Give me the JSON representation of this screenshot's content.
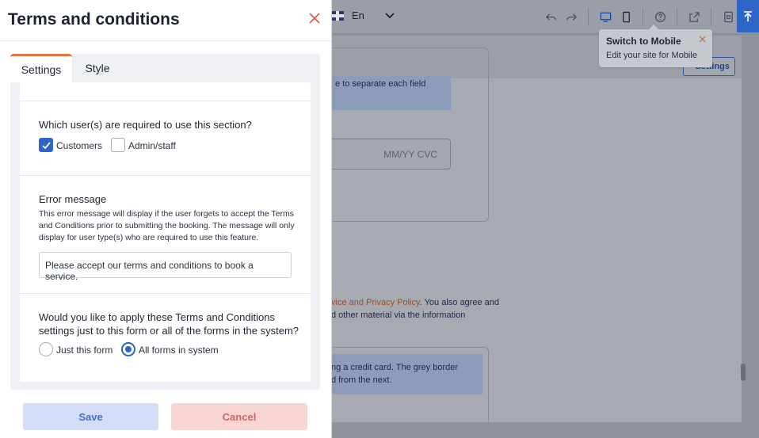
{
  "panel": {
    "title": "Terms and conditions",
    "tabs": [
      {
        "label": "Settings",
        "active": true
      },
      {
        "label": "Style",
        "active": false
      }
    ],
    "users_section": {
      "question": "Which user(s) are required to use this section?",
      "options": [
        {
          "label": "Customers",
          "checked": true
        },
        {
          "label": "Admin/staff",
          "checked": false
        }
      ]
    },
    "error_section": {
      "heading": "Error message",
      "description": "This error message will display if the user forgets to accept the Terms and Conditions prior to submitting the booking. The message will only display for user type(s) who are required to use this feature.",
      "input_value": "Please accept our terms and conditions to book a service."
    },
    "scope_section": {
      "question": "Would you like to apply these Terms and Conditions settings just to this form or all of the forms in the system?",
      "options": [
        {
          "label": "Just this form",
          "selected": false
        },
        {
          "label": "All forms in system",
          "selected": true
        }
      ]
    },
    "buttons": {
      "save": "Save",
      "cancel": "Cancel"
    }
  },
  "topbar": {
    "language": "En",
    "tooltip": {
      "title": "Switch to Mobile",
      "body": "Edit your site for Mobile"
    }
  },
  "background": {
    "settings_button": "Settings",
    "text_1": "e to separate each field",
    "card_placeholder": "MM/YY  CVC",
    "policy_link": "vice and Privacy Policy",
    "policy_text": ". You also agree and",
    "policy_text_2": "d other material via the information",
    "info_1": "ng a credit card. The grey border",
    "info_2": "d from the next."
  },
  "colors": {
    "accent": "#2d66c8",
    "tab_indicator": "#e8743b",
    "close": "#e0554b",
    "save_bg": "#d3ddf7",
    "cancel_bg": "#f8d6d4"
  },
  "icons": [
    "close-icon",
    "checkmark-icon",
    "undo-icon",
    "redo-icon",
    "desktop-icon",
    "mobile-icon",
    "help-icon",
    "external-link-icon",
    "save-page-icon",
    "scroll-top-icon",
    "chevron-down-icon",
    "uk-flag-icon"
  ]
}
